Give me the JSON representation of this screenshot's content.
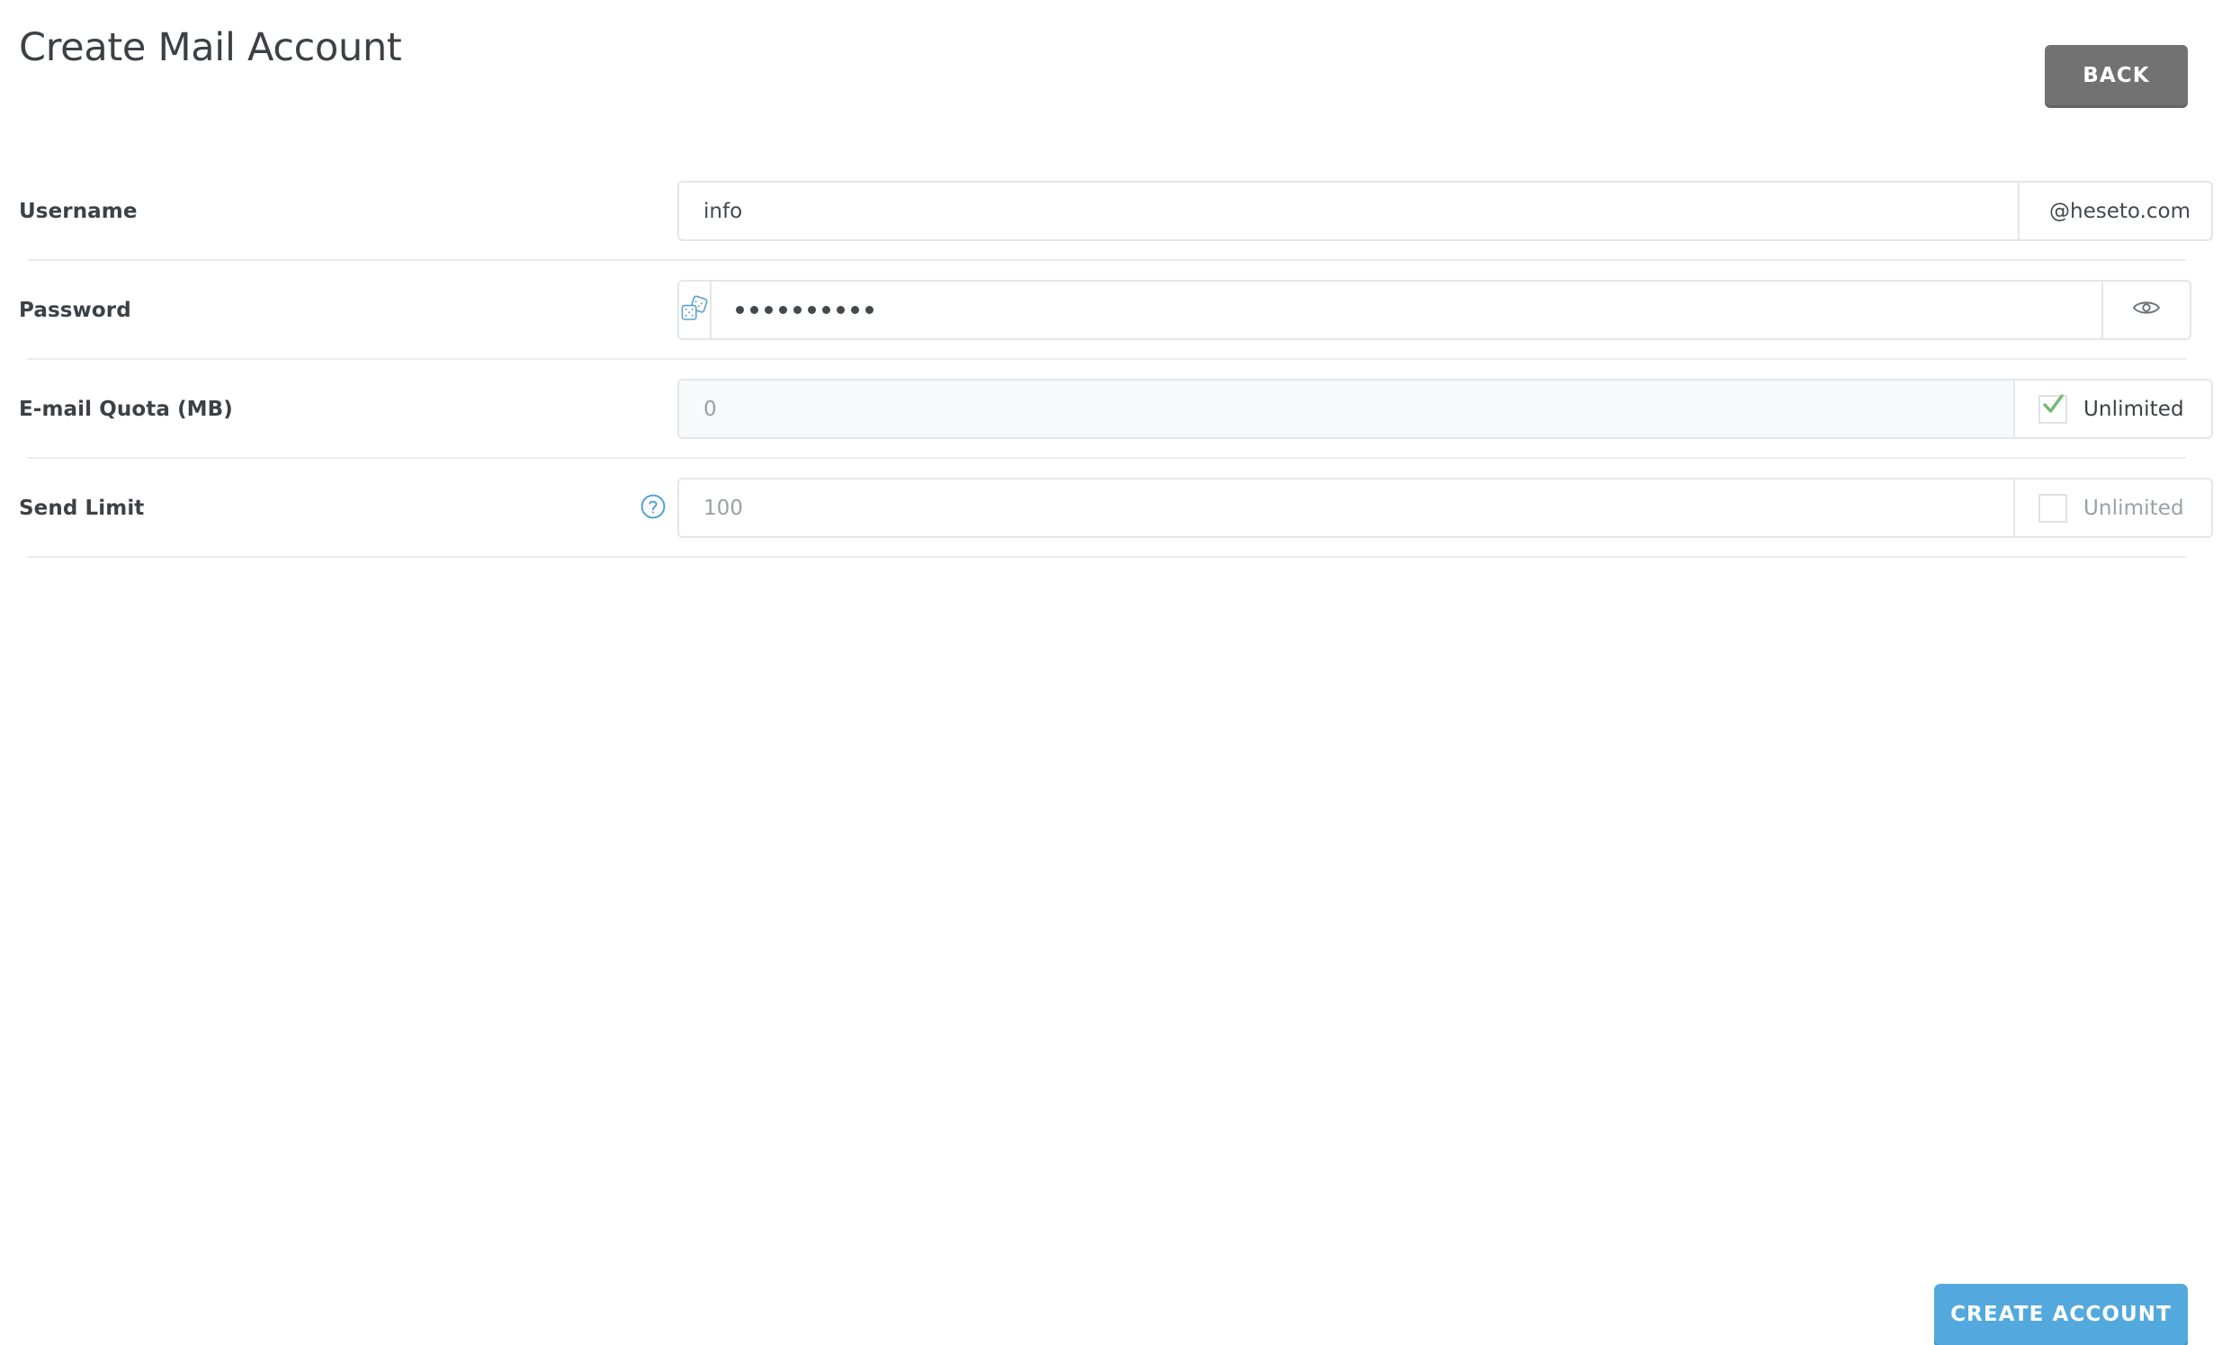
{
  "header": {
    "title": "Create Mail Account",
    "back_label": "BACK"
  },
  "form": {
    "rows": [
      {
        "label": "Username",
        "value": "info",
        "addon": "@heseto.com"
      },
      {
        "label": "Password",
        "value": "••••••••••",
        "dots": 10,
        "prefix_icon": "dice-icon",
        "suffix_icon": "eye-icon"
      },
      {
        "label": "E-mail Quota (MB)",
        "placeholder": "0",
        "checkbox_label": "Unlimited",
        "checked": true
      },
      {
        "label": "Send Limit",
        "placeholder": "100",
        "help_icon": "help-circle-icon",
        "checkbox_label": "Unlimited",
        "checked": false
      }
    ]
  },
  "footer": {
    "create_label": "CREATE ACCOUNT"
  },
  "colors": {
    "accent_blue": "#53a9dd",
    "back_gray": "#727272",
    "check_green": "#72bb72",
    "icon_blue": "#4a95c8",
    "border": "#e4e6e8",
    "separator": "#ebecee",
    "text": "#3c4146",
    "muted_text": "#9aa0a6"
  }
}
